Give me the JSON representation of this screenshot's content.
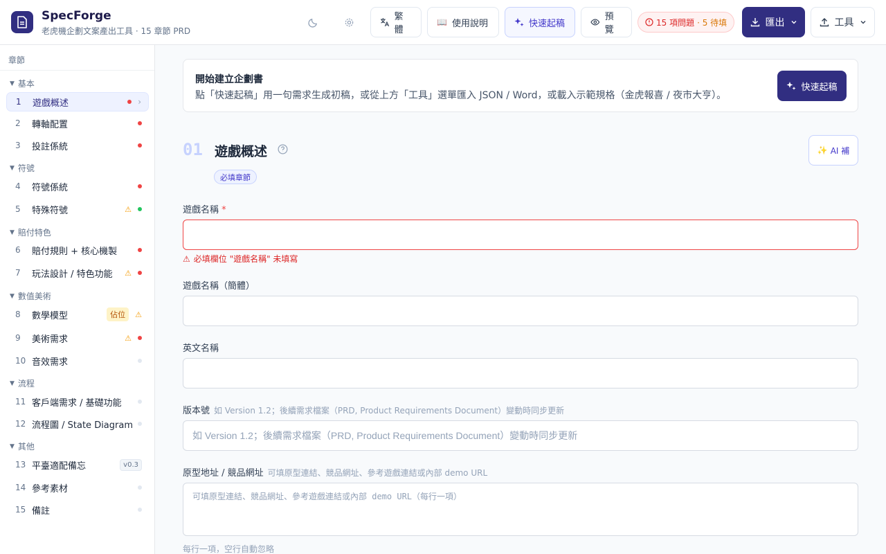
{
  "app": {
    "title": "SpecForge",
    "subtitle": "老虎機企劃文案產出工具 · 15 章節 PRD",
    "logo_icon": "document-icon"
  },
  "header": {
    "language_label": "繁體",
    "guide_label": "使用說明",
    "guide_icon": "📖",
    "quickstart_label": "快速起稿",
    "preview_label": "預覽",
    "issues_label": "15 項問題",
    "pending_label": "· 5 待填",
    "export_label": "匯出",
    "tools_label": "工具"
  },
  "sidebar": {
    "heading": "章節",
    "groups": [
      {
        "label": "基本"
      },
      {
        "label": "符號"
      },
      {
        "label": "賠付特色"
      },
      {
        "label": "數值美術"
      },
      {
        "label": "流程"
      },
      {
        "label": "其他"
      }
    ],
    "items": [
      {
        "num": "1",
        "label": "遊戲概述"
      },
      {
        "num": "2",
        "label": "轉軸配置"
      },
      {
        "num": "3",
        "label": "投註係統"
      },
      {
        "num": "4",
        "label": "符號係統"
      },
      {
        "num": "5",
        "label": "特殊符號"
      },
      {
        "num": "6",
        "label": "賠付規則 + 核心機製"
      },
      {
        "num": "7",
        "label": "玩法設計 / 特色功能"
      },
      {
        "num": "8",
        "label": "數學模型",
        "tag": "佔位"
      },
      {
        "num": "9",
        "label": "美術需求"
      },
      {
        "num": "10",
        "label": "音效需求"
      },
      {
        "num": "11",
        "label": "客戶端需求 / 基礎功能"
      },
      {
        "num": "12",
        "label": "流程圖 / State Diagram"
      },
      {
        "num": "13",
        "label": "平臺適配備忘",
        "tag": "v0.3"
      },
      {
        "num": "14",
        "label": "參考素材"
      },
      {
        "num": "15",
        "label": "備註"
      }
    ]
  },
  "banner": {
    "title": "開始建立企劃書",
    "description": "點「快速起稿」用一句需求生成初稿，或從上方「工具」選單匯入 JSON / Word，或載入示範規格（金虎報喜 / 夜市大亨）。",
    "button_label": "快速起稿"
  },
  "section": {
    "number": "01",
    "title": "遊戲概述",
    "badge": "必填章節",
    "ai_label": "AI 補"
  },
  "fields": {
    "game_name_label": "遊戲名稱",
    "game_name_required": "*",
    "game_name_value": "",
    "game_name_error": "必填欄位 \"遊戲名稱\" 未填寫",
    "game_name_sc_label": "遊戲名稱（簡體）",
    "game_name_sc_value": "",
    "english_name_label": "英文名稱",
    "english_name_value": "",
    "version_label": "版本號",
    "version_hint": "如 Version 1.2；後續需求檔案（PRD, Product Requirements Document）變動時同步更新",
    "version_placeholder": "如 Version 1.2；後續需求檔案（PRD, Product Requirements Document）變動時同步更新",
    "prototype_label": "原型地址 / 競品網址",
    "prototype_hint": "可填原型連結、競品網址、參考遊戲連結或內部 demo URL",
    "prototype_placeholder": "可填原型連結、競品網址、參考遊戲連結或內部 demo URL（每行一項）",
    "prototype_foot": "每行一項，空行自動忽略"
  },
  "colors": {
    "brand": "#312e81",
    "accent": "#4338ca",
    "error": "#ef4444",
    "warning": "#f59e0b",
    "success": "#22c55e"
  }
}
